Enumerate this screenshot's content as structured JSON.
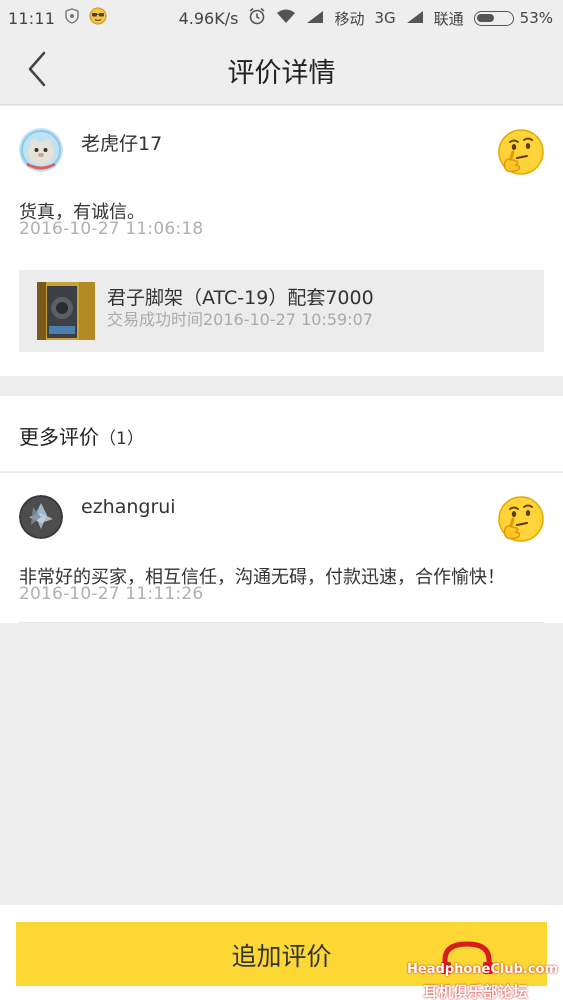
{
  "status_bar": {
    "time": "11:11",
    "speed": "4.96K/s",
    "carrier1": "移动",
    "network": "3G",
    "carrier2": "联通",
    "battery": "53%",
    "battery_level": 0.53
  },
  "header": {
    "title": "评价详情",
    "back_icon": "chevron-left-icon"
  },
  "main_review": {
    "username": "老虎仔17",
    "text": "货真，有诚信。",
    "time": "2016-10-27 11:06:18",
    "emoji": "thinking-face-icon",
    "order": {
      "title": "君子脚架（ATC-19）配套7000",
      "subtitle": "交易成功时间2016-10-27 10:59:07"
    }
  },
  "more": {
    "title": "更多评价",
    "count": "（1）"
  },
  "reviews": [
    {
      "username": "ezhangrui",
      "text": "非常好的买家，相互信任，沟通无碍，付款迅速，合作愉快！",
      "time": "2016-10-27 11:11:26",
      "emoji": "thinking-face-icon"
    }
  ],
  "bottom": {
    "add_label": "追加评价",
    "watermark_line1": "HeadphoneClub.com",
    "watermark_line2": "耳机俱乐部论坛"
  },
  "colors": {
    "accent": "#fdd835",
    "background": "#eeeeee",
    "time_text": "#b0b0b0"
  }
}
